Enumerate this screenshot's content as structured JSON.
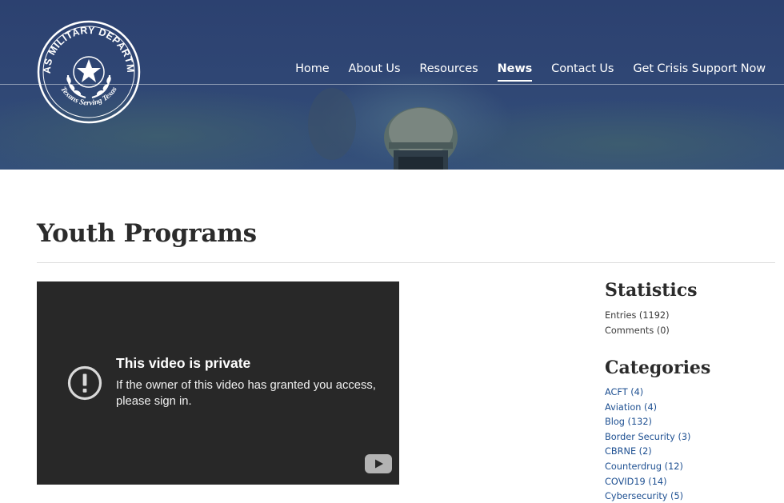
{
  "seal": {
    "top_text": "TEXAS MILITARY DEPARTMENT",
    "bottom_text": "Texans Serving Texas"
  },
  "nav": {
    "items": [
      {
        "label": "Home",
        "active": false
      },
      {
        "label": "About Us",
        "active": false
      },
      {
        "label": "Resources",
        "active": false
      },
      {
        "label": "News",
        "active": true
      },
      {
        "label": "Contact Us",
        "active": false
      },
      {
        "label": "Get Crisis Support Now",
        "active": false
      }
    ]
  },
  "page": {
    "title": "Youth Programs"
  },
  "video": {
    "title": "This video is private",
    "message": "If the owner of this video has granted you access, please sign in.",
    "alert_icon": "exclamation-circle-icon",
    "logo_icon": "youtube-icon"
  },
  "sidebar": {
    "statistics": {
      "heading": "Statistics",
      "items": [
        "Entries (1192)",
        "Comments (0)"
      ]
    },
    "categories": {
      "heading": "Categories",
      "items": [
        "ACFT (4)",
        "Aviation (4)",
        "Blog (132)",
        "Border Security (3)",
        "CBRNE (2)",
        "Counterdrug (12)",
        "COVID19 (14)",
        "Cybersecurity (5)"
      ]
    }
  },
  "colors": {
    "hero_blue": "#2f4674",
    "link_blue": "#1d4f91",
    "video_bg": "#282828"
  }
}
